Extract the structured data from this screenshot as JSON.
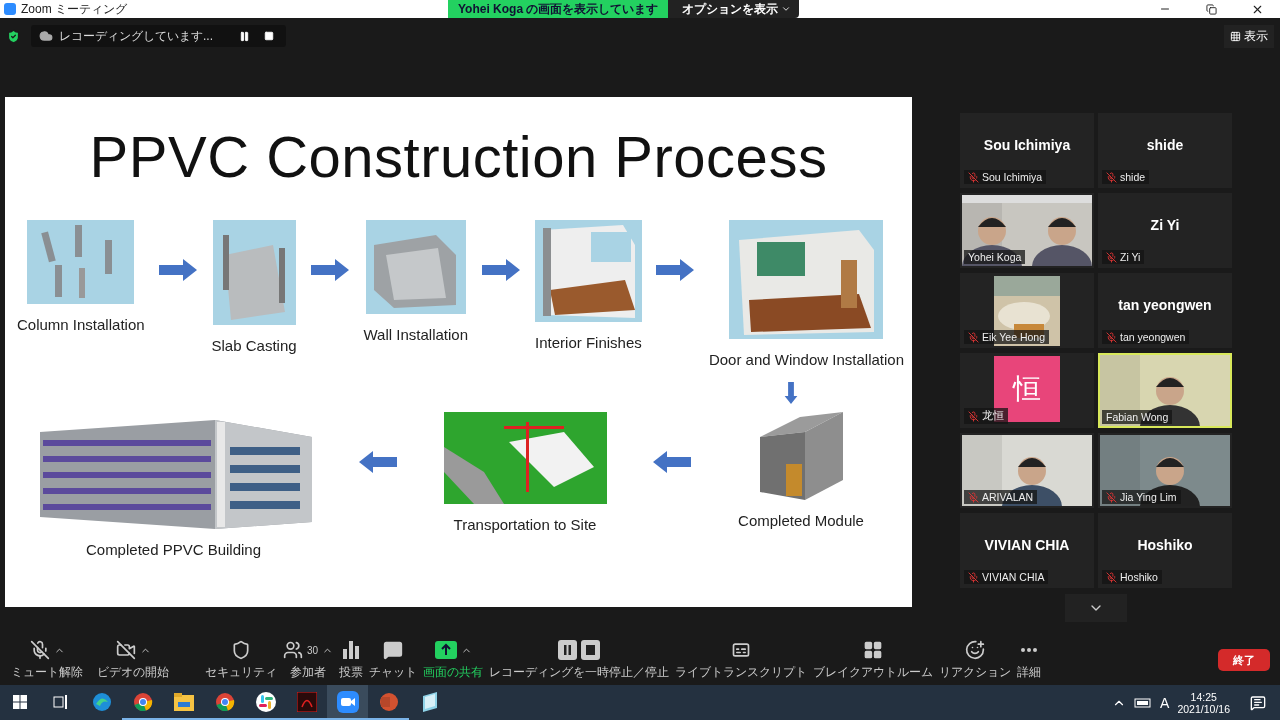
{
  "window": {
    "title": "Zoom ミーティング"
  },
  "share_banner": {
    "text": "Yohei  Koga の画面を表示しています",
    "options_button": "オプションを表示"
  },
  "recording": {
    "text": "レコーディングしています..."
  },
  "view_button": {
    "label": "表示"
  },
  "slide": {
    "title": "PPVC Construction Process",
    "top_row": [
      {
        "label": "Column Installation"
      },
      {
        "label": "Slab Casting"
      },
      {
        "label": "Wall Installation"
      },
      {
        "label": "Interior Finishes"
      },
      {
        "label": "Door and Window Installation"
      }
    ],
    "bottom_row": [
      {
        "label": "Completed PPVC Building"
      },
      {
        "label": "Transportation to Site"
      },
      {
        "label": "Completed Module"
      }
    ]
  },
  "participants": [
    {
      "display_name": "Sou Ichimiya",
      "name": "Sou Ichimiya",
      "kind": "name",
      "muted": true,
      "speaking": false
    },
    {
      "display_name": "shide",
      "name": "shide",
      "kind": "name",
      "muted": true,
      "speaking": false
    },
    {
      "name": "Yohei Koga",
      "kind": "video",
      "muted": false,
      "speaking": false
    },
    {
      "display_name": "Zi Yi",
      "name": "Zi Yi",
      "kind": "name",
      "muted": true,
      "speaking": false
    },
    {
      "name": "Eik Yee Hong",
      "muted": true,
      "speaking": false
    },
    {
      "display_name": "tan yeongwen",
      "name": "tan yeongwen",
      "kind": "name",
      "muted": true,
      "speaking": false
    },
    {
      "name": "龙恒",
      "kind": "avatar",
      "avatar": "恒",
      "muted": true,
      "speaking": false
    },
    {
      "name": "Fabian Wong",
      "kind": "video",
      "muted": false,
      "speaking": true
    },
    {
      "name": "ARIVALAN",
      "kind": "video",
      "muted": true,
      "speaking": false
    },
    {
      "name": "Jia Ying Lim",
      "kind": "video",
      "muted": true,
      "speaking": false
    },
    {
      "display_name": "VIVIAN CHIA",
      "name": "VIVIAN CHIA",
      "kind": "name",
      "muted": true,
      "speaking": false
    },
    {
      "display_name": "Hoshiko",
      "name": "Hoshiko",
      "kind": "name",
      "muted": true,
      "speaking": false
    }
  ],
  "toolbar": {
    "left": [
      {
        "kind": "mic",
        "label": "ミュート解除",
        "caret": true,
        "highlighted": false
      },
      {
        "kind": "video",
        "label": "ビデオの開始",
        "caret": true,
        "highlighted": false
      }
    ],
    "center": [
      {
        "kind": "security",
        "label": "セキュリティ",
        "caret": false,
        "highlighted": false
      },
      {
        "kind": "participants",
        "label": "参加者",
        "count": "30",
        "caret": true,
        "highlighted": false
      },
      {
        "kind": "poll",
        "label": "投票",
        "caret": false,
        "highlighted": false
      },
      {
        "kind": "chat",
        "label": "チャット",
        "caret": false,
        "highlighted": false
      },
      {
        "kind": "share",
        "label": "画面の共有",
        "caret": true,
        "highlighted": true
      },
      {
        "kind": "record",
        "label": "レコーディングを一時停止／停止",
        "caret": false,
        "highlighted": false
      },
      {
        "kind": "captions",
        "label": "ライブトランスクリプト",
        "caret": false,
        "highlighted": false
      },
      {
        "kind": "breakout",
        "label": "ブレイクアウトルーム",
        "caret": false,
        "highlighted": false
      },
      {
        "kind": "reaction",
        "label": "リアクション",
        "caret": false,
        "highlighted": false
      },
      {
        "kind": "more",
        "label": "詳細",
        "caret": false,
        "highlighted": false
      }
    ],
    "end_button": "終了"
  },
  "taskbar": {
    "apps": [
      {
        "kind": "edge",
        "running": false,
        "selected": false
      },
      {
        "kind": "chrome",
        "running": true,
        "selected": false
      },
      {
        "kind": "explorer",
        "running": true,
        "selected": false
      },
      {
        "kind": "chrome",
        "running": true,
        "selected": false
      },
      {
        "kind": "slack",
        "running": true,
        "selected": false
      },
      {
        "kind": "acrobat",
        "running": true,
        "selected": false
      },
      {
        "kind": "zoom",
        "running": true,
        "selected": true
      },
      {
        "kind": "powerpoint",
        "running": true,
        "selected": false
      },
      {
        "kind": "notepad",
        "running": false,
        "selected": false
      }
    ],
    "ime": "A",
    "time": "14:25",
    "date": "2021/10/16"
  }
}
